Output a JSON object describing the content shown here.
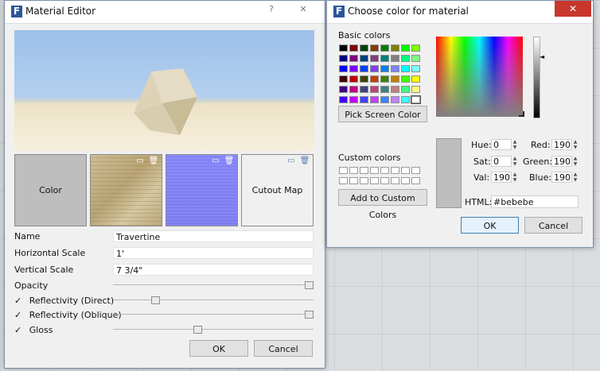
{
  "material_editor": {
    "title": "Material Editor",
    "help_button": "?",
    "close_button": "✕",
    "tiles": [
      {
        "label": "Color",
        "color": "#bebebe"
      },
      {
        "label": "",
        "kind": "diffuse-map"
      },
      {
        "label": "",
        "kind": "normal-map"
      },
      {
        "label": "Cutout Map",
        "color": "#f0f0f0"
      }
    ],
    "fields": {
      "name_label": "Name",
      "name_value": "Travertine",
      "hscale_label": "Horizontal Scale",
      "hscale_value": "1'",
      "vscale_label": "Vertical Scale",
      "vscale_value": "7 3/4\""
    },
    "sliders": {
      "opacity_label": "Opacity",
      "refl_direct_label": "Reflectivity (Direct)",
      "refl_oblique_label": "Reflectivity (Oblique)",
      "gloss_label": "Gloss"
    },
    "checkmark": "✓",
    "ok_label": "OK",
    "cancel_label": "Cancel"
  },
  "color_dialog": {
    "title": "Choose color for material",
    "close_button": "✕",
    "basic_colors_label": "Basic colors",
    "pick_screen_label": "Pick Screen Color",
    "custom_colors_label": "Custom colors",
    "add_custom_label": "Add to Custom Colors",
    "hue_label": "Hue:",
    "hue_value": "0",
    "sat_label": "Sat:",
    "sat_value": "0",
    "val_label": "Val:",
    "val_value": "190",
    "red_label": "Red:",
    "red_value": "190",
    "green_label": "Green:",
    "green_value": "190",
    "blue_label": "Blue:",
    "blue_value": "190",
    "html_label": "HTML:",
    "html_value": "#bebebe",
    "ok_label": "OK",
    "cancel_label": "Cancel",
    "current_color": "#bebebe",
    "basic_colors": [
      "#000000",
      "#800000",
      "#004000",
      "#804000",
      "#008000",
      "#808000",
      "#00ff00",
      "#80ff00",
      "#000080",
      "#800080",
      "#004080",
      "#804080",
      "#008080",
      "#808080",
      "#00ff80",
      "#80ff80",
      "#0000ff",
      "#8000ff",
      "#0040ff",
      "#8040ff",
      "#0080ff",
      "#8080ff",
      "#00ffff",
      "#80ffff",
      "#400000",
      "#c00000",
      "#404000",
      "#c04000",
      "#408000",
      "#c08000",
      "#40ff00",
      "#ffff00",
      "#400080",
      "#c00080",
      "#404080",
      "#c04080",
      "#408080",
      "#c08080",
      "#40ff80",
      "#ffff80",
      "#4000ff",
      "#c000ff",
      "#4040ff",
      "#c040ff",
      "#4080ff",
      "#c080ff",
      "#40ffff",
      "#ffffff"
    ]
  },
  "app_logo_letter": "F"
}
